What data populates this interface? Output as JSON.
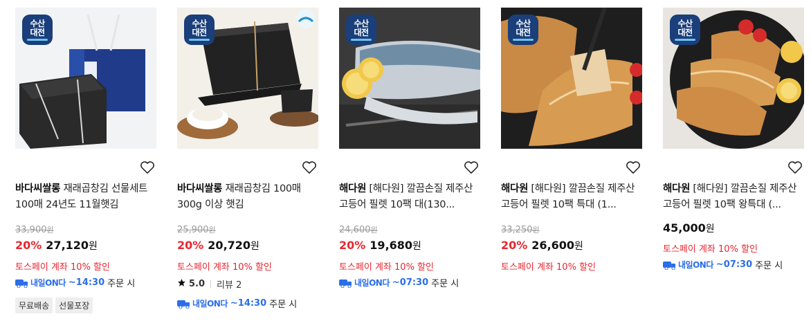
{
  "products": [
    {
      "badge": {
        "line1": "수산",
        "line2": "대전"
      },
      "brand": "바다씨쌀롱",
      "name": " 재래곱창김 선물세트 100매 24년도 11월햇김",
      "original_price": "33,900",
      "original_unit": "원",
      "discount": "20%",
      "price": "27,120",
      "price_unit": "원",
      "promo": "토스페이 계좌 10% 할인",
      "delivery": {
        "label": "내일ON다",
        "time": "~14:30",
        "suffix": "주문 시"
      },
      "tags": [
        "무료배송",
        "선물포장"
      ]
    },
    {
      "badge": {
        "line1": "수산",
        "line2": "대전"
      },
      "brand": "바다씨쌀롱",
      "name": " 재래곱창김 100매 300g 이상 햇김",
      "original_price": "25,900",
      "original_unit": "원",
      "discount": "20%",
      "price": "20,720",
      "price_unit": "원",
      "promo": "토스페이 계좌 10% 할인",
      "rating": {
        "score": "5.0",
        "reviews": "리뷰 2"
      },
      "delivery": {
        "label": "내일ON다",
        "time": "~14:30",
        "suffix": "주문 시"
      }
    },
    {
      "badge": {
        "line1": "수산",
        "line2": "대전"
      },
      "brand": "해다원",
      "name": " [해다원] 깔끔손질 제주산 고등어 필렛 10팩 대(130...",
      "original_price": "24,600",
      "original_unit": "원",
      "discount": "20%",
      "price": "19,680",
      "price_unit": "원",
      "promo": "토스페이 계좌 10% 할인",
      "delivery": {
        "label": "내일ON다",
        "time": "~07:30",
        "suffix": "주문 시"
      }
    },
    {
      "badge": {
        "line1": "수산",
        "line2": "대전"
      },
      "brand": "해다원",
      "name": " [해다원] 깔끔손질 제주산 고등어 필렛 10팩 특대 (1...",
      "original_price": "33,250",
      "original_unit": "원",
      "discount": "20%",
      "price": "26,600",
      "price_unit": "원",
      "promo": "토스페이 계좌 10% 할인"
    },
    {
      "badge": {
        "line1": "수산",
        "line2": "대전"
      },
      "brand": "해다원",
      "name": " [해다원] 깔끔손질 제주산 고등어 필렛 10팩 왕특대 (...",
      "price": "45,000",
      "price_unit": "원",
      "promo": "토스페이 계좌 10% 할인",
      "delivery": {
        "label": "내일ON다",
        "time": "~07:30",
        "suffix": "주문 시"
      }
    }
  ],
  "colors": {
    "discount": "#e8262f",
    "delivery": "#2b6ee8",
    "badge": "#1a3f7a"
  }
}
